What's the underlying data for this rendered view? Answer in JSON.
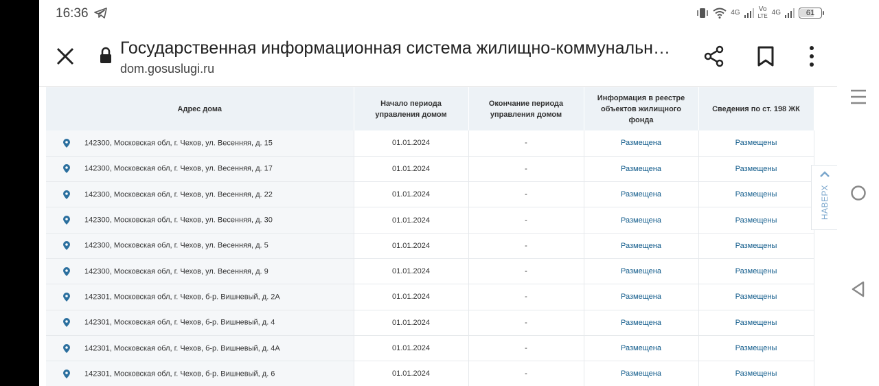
{
  "status": {
    "time": "16:36",
    "net1": "4G",
    "volte_top": "Vo",
    "volte_bottom": "LTE",
    "net2": "4G",
    "battery": "61"
  },
  "browser": {
    "title": "Государственная информационная система жилищно-коммунальн…",
    "url": "dom.gosuslugi.ru"
  },
  "table": {
    "headers": [
      "Адрес дома",
      "Начало периода управления домом",
      "Окончание периода управления домом",
      "Информация в реестре объектов жилищного фонда",
      "Сведения по ст. 198 ЖК"
    ],
    "rows": [
      {
        "address": "142300, Московская обл, г. Чехов, ул. Весенняя, д. 15",
        "start": "01.01.2024",
        "end": "-",
        "registry": "Размещена",
        "art198": "Размещены"
      },
      {
        "address": "142300, Московская обл, г. Чехов, ул. Весенняя, д. 17",
        "start": "01.01.2024",
        "end": "-",
        "registry": "Размещена",
        "art198": "Размещены"
      },
      {
        "address": "142300, Московская обл, г. Чехов, ул. Весенняя, д. 22",
        "start": "01.01.2024",
        "end": "-",
        "registry": "Размещена",
        "art198": "Размещены"
      },
      {
        "address": "142300, Московская обл, г. Чехов, ул. Весенняя, д. 30",
        "start": "01.01.2024",
        "end": "-",
        "registry": "Размещена",
        "art198": "Размещены"
      },
      {
        "address": "142300, Московская обл, г. Чехов, ул. Весенняя, д. 5",
        "start": "01.01.2024",
        "end": "-",
        "registry": "Размещена",
        "art198": "Размещены"
      },
      {
        "address": "142300, Московская обл, г. Чехов, ул. Весенняя, д. 9",
        "start": "01.01.2024",
        "end": "-",
        "registry": "Размещена",
        "art198": "Размещены"
      },
      {
        "address": "142301, Московская обл, г. Чехов, б-р. Вишневый, д. 2А",
        "start": "01.01.2024",
        "end": "-",
        "registry": "Размещена",
        "art198": "Размещены"
      },
      {
        "address": "142301, Московская обл, г. Чехов, б-р. Вишневый, д. 4",
        "start": "01.01.2024",
        "end": "-",
        "registry": "Размещена",
        "art198": "Размещены"
      },
      {
        "address": "142301, Московская обл, г. Чехов, б-р. Вишневый, д. 4А",
        "start": "01.01.2024",
        "end": "-",
        "registry": "Размещена",
        "art198": "Размещены"
      },
      {
        "address": "142301, Московская обл, г. Чехов, б-р. Вишневый, д. 6",
        "start": "01.01.2024",
        "end": "-",
        "registry": "Размещена",
        "art198": "Размещены"
      }
    ]
  },
  "to_top_label": "НАВЕРХ",
  "colors": {
    "link": "#0f5a8a",
    "pin": "#2b6f9e",
    "header_bg": "#edf2f6",
    "to_top": "#7aa6cc"
  },
  "icons": [
    "telegram-icon",
    "vibrate-icon",
    "wifi-icon",
    "signal-icon",
    "battery-icon",
    "close-icon",
    "lock-icon",
    "share-icon",
    "bookmark-icon",
    "more-icon",
    "map-pin-icon",
    "chevron-up-icon",
    "recent-apps-icon",
    "home-icon",
    "back-icon"
  ]
}
